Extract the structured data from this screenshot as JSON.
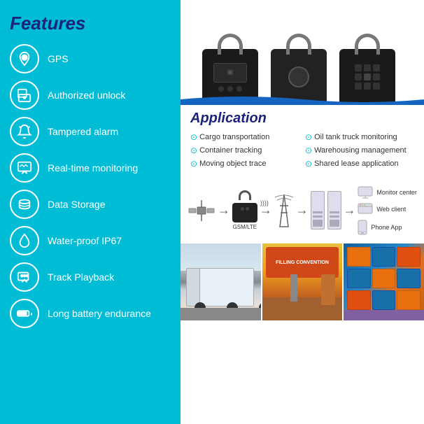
{
  "leftPanel": {
    "title": "Features",
    "features": [
      {
        "id": "gps",
        "label": "GPS",
        "icon": "location"
      },
      {
        "id": "authorized-unlock",
        "label": "Authorized unlock",
        "icon": "lock-screen"
      },
      {
        "id": "tampered-alarm",
        "label": "Tampered alarm",
        "icon": "alarm"
      },
      {
        "id": "realtime-monitoring",
        "label": "Real-time monitoring",
        "icon": "monitor"
      },
      {
        "id": "data-storage",
        "label": "Data Storage",
        "icon": "storage"
      },
      {
        "id": "waterproof",
        "label": "Water-proof IP67",
        "icon": "water"
      },
      {
        "id": "track-playback",
        "label": "Track Playback",
        "icon": "track"
      },
      {
        "id": "battery",
        "label": "Long battery endurance",
        "icon": "battery"
      }
    ]
  },
  "rightPanel": {
    "application": {
      "title": "Application",
      "items": [
        "Cargo transportation",
        "Container tracking",
        "Moving object trace",
        "Oil tank truck monitoring",
        "Warehousing management",
        "Shared lease application"
      ]
    },
    "diagram": {
      "labels": {
        "gsm": "GSM/LTE",
        "monitor": "Monitor center",
        "webClient": "Web client",
        "phoneApp": "Phone App"
      }
    },
    "photos": [
      {
        "id": "truck",
        "alt": "Cargo truck"
      },
      {
        "id": "gas-station",
        "alt": "Gas station"
      },
      {
        "id": "containers",
        "alt": "Shipping containers"
      }
    ]
  }
}
